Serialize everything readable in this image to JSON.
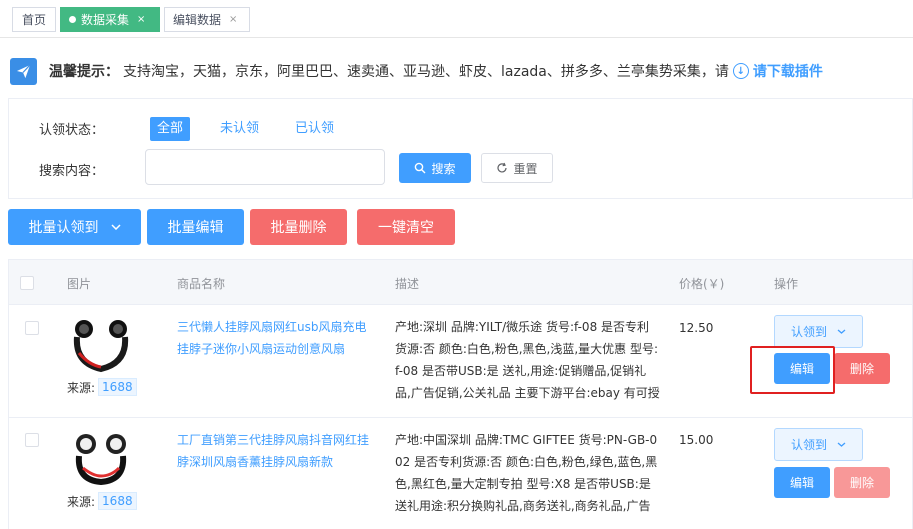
{
  "tabs": {
    "home": "首页",
    "active": "数据采集",
    "edit": "编辑数据",
    "close_glyph": "×"
  },
  "tip": {
    "title": "温馨提示：",
    "text": "支持淘宝，天猫，京东，阿里巴巴、速卖通、亚马逊、虾皮、lazada、拼多多、兰亭集势采集，请",
    "link": "请下载插件"
  },
  "filter": {
    "status_label": "认领状态：",
    "status_options": [
      "全部",
      "未认领",
      "已认领"
    ],
    "search_label": "搜索内容：",
    "search_value": "",
    "search_button": "搜索",
    "reset_button": "重置"
  },
  "actions": {
    "batch_claim": "批量认领到",
    "batch_edit": "批量编辑",
    "batch_delete": "批量删除",
    "clear_all": "一键清空"
  },
  "table": {
    "columns": [
      "图片",
      "商品名称",
      "描述",
      "价格(￥)",
      "操作"
    ],
    "rows": [
      {
        "source_label": "来源:",
        "source": "1688",
        "name": "三代懒人挂脖风扇网红usb风扇充电挂脖子迷你小风扇运动创意风扇",
        "desc": "产地:深圳 品牌:YILT/微乐途 货号:f-08 是否专利货源:否 颜色:白色,粉色,黑色,浅蓝,量大优惠 型号:f-08 是否带USB:是 送礼,用途:促销赠品,促销礼品,广告促销,公关礼品 主要下游平台:ebay 有可授权...",
        "price": "12.50",
        "claim": "认领到",
        "edit": "编辑",
        "delete": "删除"
      },
      {
        "source_label": "来源:",
        "source": "1688",
        "name": "工厂直销第三代挂脖风扇抖音网红挂脖深圳风扇香薰挂脖风扇新款",
        "desc": "产地:中国深圳 品牌:TMC GIFTEE 货号:PN-GB-002 是否专利货源:否 颜色:白色,粉色,绿色,蓝色,黑色,黑红色,量大定制专拍 型号:X8 是否带USB:是 送礼用途:积分换购礼品,商务送礼,商务礼品,广告礼品,...",
        "price": "15.00",
        "claim": "认领到",
        "edit": "编辑",
        "delete": "删除"
      }
    ]
  },
  "colors": {
    "primary": "#409eff",
    "danger": "#f56c6c",
    "tab_active": "#42b983",
    "highlight": "#e02020"
  }
}
